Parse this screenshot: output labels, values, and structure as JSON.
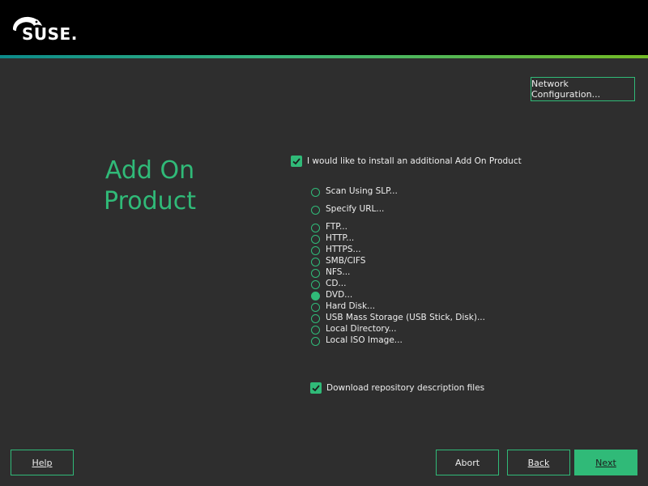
{
  "branding": {
    "logo_text": "SUSE."
  },
  "header": {
    "network_button": "Network Configuration..."
  },
  "page": {
    "title_line1": "Add On",
    "title_line2": "Product"
  },
  "install_addon": {
    "label": "I would like to install an additional Add On Product",
    "checked": true
  },
  "sources": [
    {
      "label": "Scan Using SLP...",
      "selected": false
    },
    {
      "label": "Specify URL...",
      "selected": false
    },
    {
      "label": "FTP...",
      "selected": false
    },
    {
      "label": "HTTP...",
      "selected": false
    },
    {
      "label": "HTTPS...",
      "selected": false
    },
    {
      "label": "SMB/CIFS",
      "selected": false
    },
    {
      "label": "NFS...",
      "selected": false
    },
    {
      "label": "CD...",
      "selected": false
    },
    {
      "label": "DVD...",
      "selected": true
    },
    {
      "label": "Hard Disk...",
      "selected": false
    },
    {
      "label": "USB Mass Storage (USB Stick, Disk)...",
      "selected": false
    },
    {
      "label": "Local Directory...",
      "selected": false
    },
    {
      "label": "Local ISO Image...",
      "selected": false
    }
  ],
  "download_desc": {
    "label": "Download repository description files",
    "checked": true
  },
  "footer": {
    "help": "Help",
    "abort": "Abort",
    "back": "Back",
    "next": "Next"
  },
  "colors": {
    "accent": "#30ba78",
    "background": "#2e2e2e",
    "topbar": "#000000"
  }
}
